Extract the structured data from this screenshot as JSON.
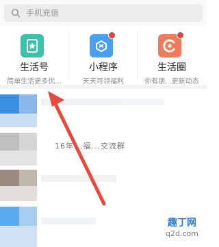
{
  "search": {
    "placeholder": "手机充值"
  },
  "shortcuts": [
    {
      "title": "生活号",
      "subtitle": "简单生活更多优...",
      "color": "#3cc2a8",
      "badge": false
    },
    {
      "title": "小程序",
      "subtitle": "天天可领福利",
      "color": "#4aa0f0",
      "badge": true
    },
    {
      "title": "生活圈",
      "subtitle": "你有朋...更新动态",
      "color": "#f07a5a",
      "badge": true
    }
  ],
  "list": {
    "partial_text": "16年...福...交流群"
  },
  "annotation": {
    "color": "#e8493f"
  },
  "watermark": {
    "main": "趣丁网",
    "sub": "q2d.com"
  }
}
